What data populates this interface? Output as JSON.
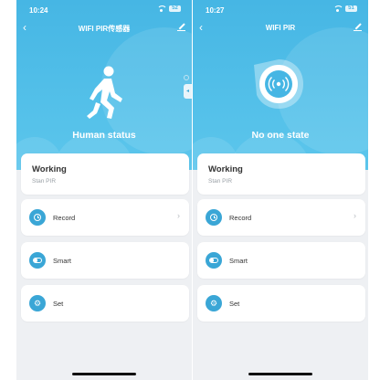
{
  "screens": [
    {
      "status_bar": {
        "time": "10:24",
        "battery": "52"
      },
      "nav": {
        "title": "WIFI PIR传感器"
      },
      "hero": {
        "state_label": "Human status",
        "icon": "walking-person-icon"
      },
      "status_card": {
        "heading": "Working",
        "sub": "Stan PIR"
      },
      "rows": [
        {
          "label": "Record",
          "icon": "clock-icon"
        },
        {
          "label": "Smart",
          "icon": "toggle-icon"
        },
        {
          "label": "Set",
          "icon": "gear-icon"
        }
      ],
      "side_tab": {
        "glyph": "◂"
      }
    },
    {
      "status_bar": {
        "time": "10:27",
        "battery": "51"
      },
      "nav": {
        "title": "WIFI PIR"
      },
      "hero": {
        "state_label": "No one state",
        "icon": "sensor-signal-icon"
      },
      "status_card": {
        "heading": "Working",
        "sub": "Stan PIR"
      },
      "rows": [
        {
          "label": "Record",
          "icon": "clock-icon"
        },
        {
          "label": "Smart",
          "icon": "toggle-icon"
        },
        {
          "label": "Set",
          "icon": "gear-icon"
        }
      ]
    }
  ],
  "glyphs": {
    "back": "‹",
    "chevron_right": "›",
    "gear": "⚙",
    "signal": "((•))"
  },
  "colors": {
    "hero_top": "#46b6e4",
    "hero_bottom": "#5cc6ec",
    "accent": "#3aa6d6",
    "page_bg": "#eef0f3"
  }
}
